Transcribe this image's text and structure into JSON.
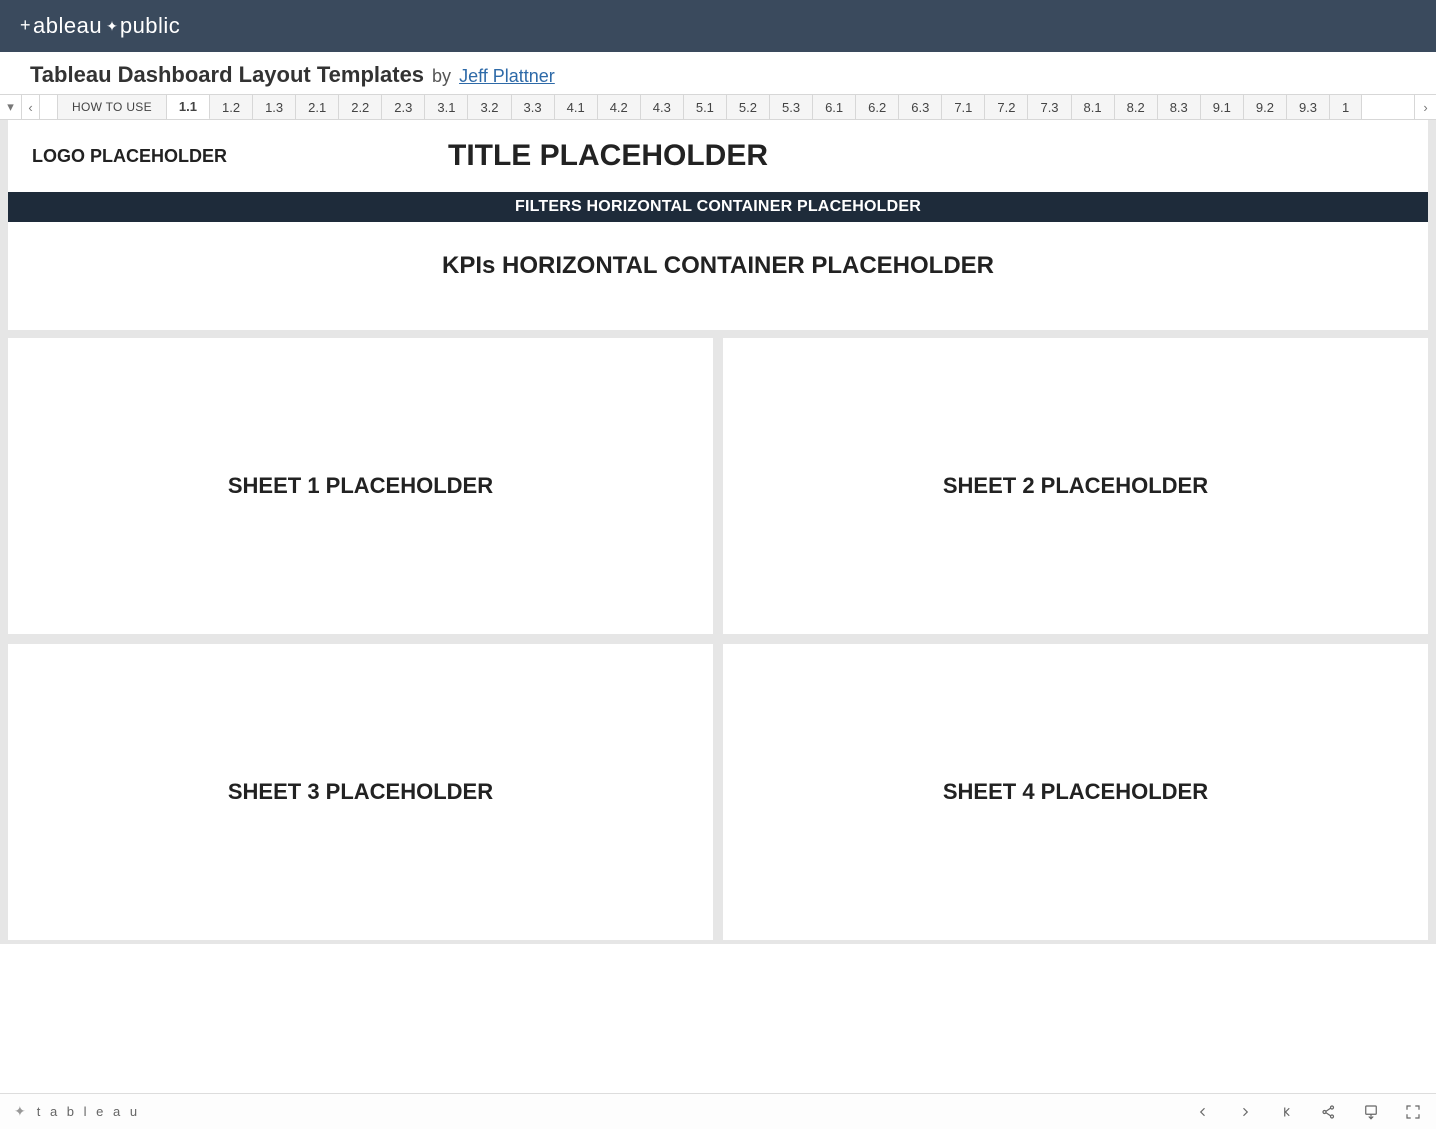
{
  "brand": {
    "name_left": "ableau",
    "name_right": "public"
  },
  "header": {
    "title": "Tableau Dashboard Layout Templates",
    "by": "by",
    "author": "Jeff Plattner"
  },
  "tabs": {
    "howto": "HOW TO USE",
    "list": [
      "1.1",
      "1.2",
      "1.3",
      "2.1",
      "2.2",
      "2.3",
      "3.1",
      "3.2",
      "3.3",
      "4.1",
      "4.2",
      "4.3",
      "5.1",
      "5.2",
      "5.3",
      "6.1",
      "6.2",
      "6.3",
      "7.1",
      "7.2",
      "7.3",
      "8.1",
      "8.2",
      "8.3",
      "9.1",
      "9.2",
      "9.3",
      "1"
    ],
    "active": "1.1"
  },
  "dashboard": {
    "logo": "LOGO PLACEHOLDER",
    "title": "TITLE PLACEHOLDER",
    "filters": "FILTERS HORIZONTAL CONTAINER PLACEHOLDER",
    "kpis": "KPIs HORIZONTAL CONTAINER PLACEHOLDER",
    "sheet1": "SHEET 1 PLACEHOLDER",
    "sheet2": "SHEET 2 PLACEHOLDER",
    "sheet3": "SHEET 3 PLACEHOLDER",
    "sheet4": "SHEET 4 PLACEHOLDER"
  },
  "footer": {
    "brand": "t a b l e a u"
  }
}
